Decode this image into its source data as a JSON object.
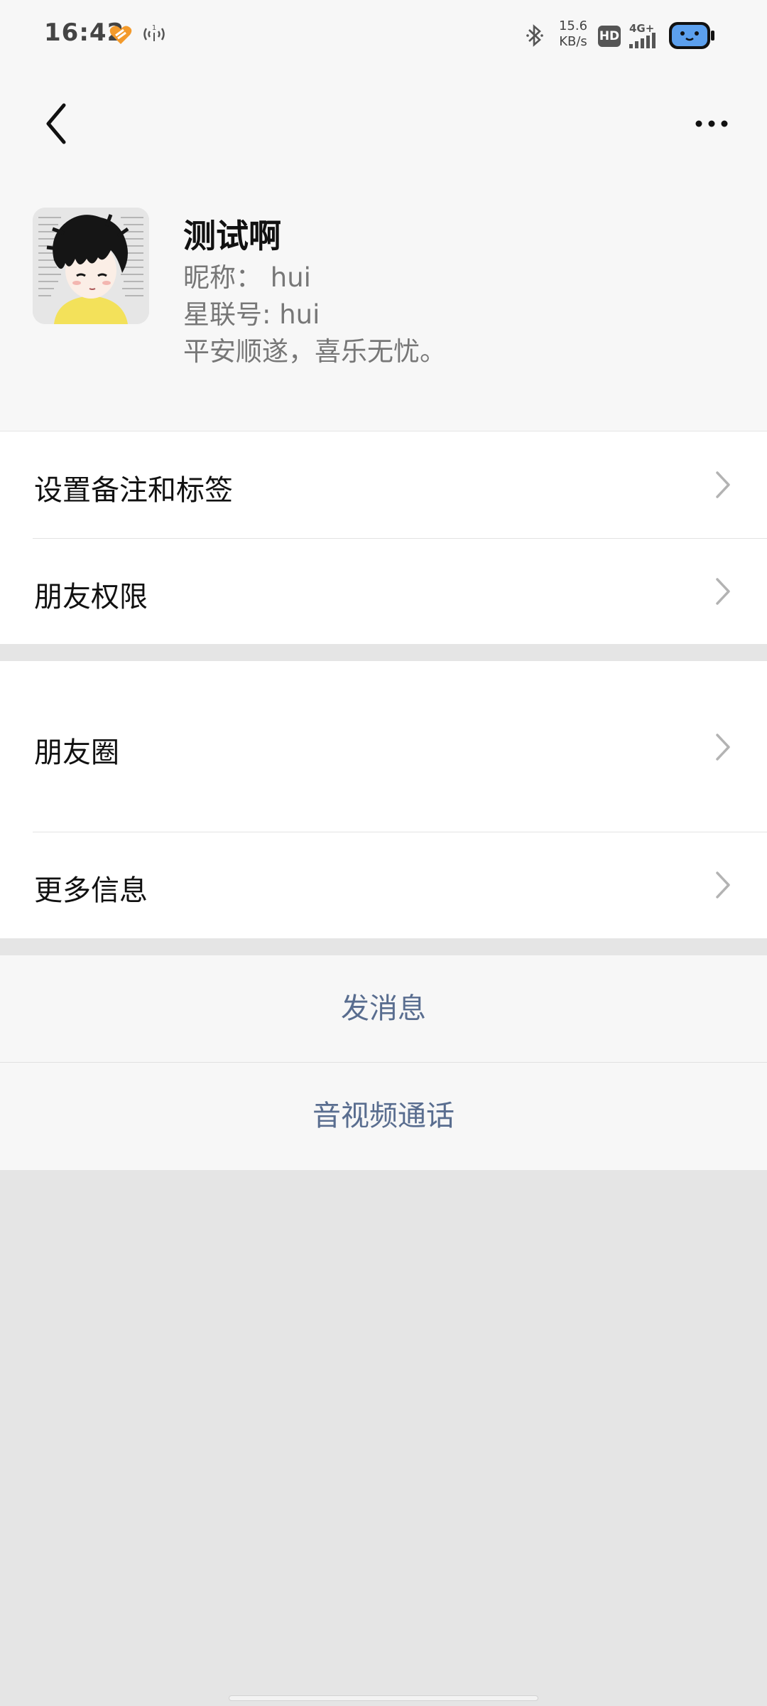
{
  "status_bar": {
    "time": "16:42",
    "net_speed_value": "15.6",
    "net_speed_unit": "KB/s",
    "hd_label": "HD",
    "signal_label": "4G+",
    "icons": [
      "heart-icon",
      "cast-icon",
      "bluetooth-icon",
      "hd-icon",
      "signal-icon",
      "battery-icon"
    ]
  },
  "nav": {
    "back_icon": "chevron-left-icon",
    "more_icon": "more-dots-icon"
  },
  "profile": {
    "name": "测试啊",
    "nickname_line": "昵称：  hui",
    "id_line": "星联号: hui",
    "signature": "平安顺遂，喜乐无忧。"
  },
  "section1": {
    "items": [
      {
        "label": "设置备注和标签"
      },
      {
        "label": "朋友权限"
      }
    ]
  },
  "section2": {
    "items": [
      {
        "label": "朋友圈"
      },
      {
        "label": "更多信息"
      }
    ]
  },
  "actions": {
    "send_message": "发消息",
    "av_call": "音视频通话"
  },
  "colors": {
    "action_text": "#596d8f",
    "page_bg": "#e5e5e5",
    "header_bg": "#f7f7f7",
    "list_bg": "#ffffff"
  }
}
